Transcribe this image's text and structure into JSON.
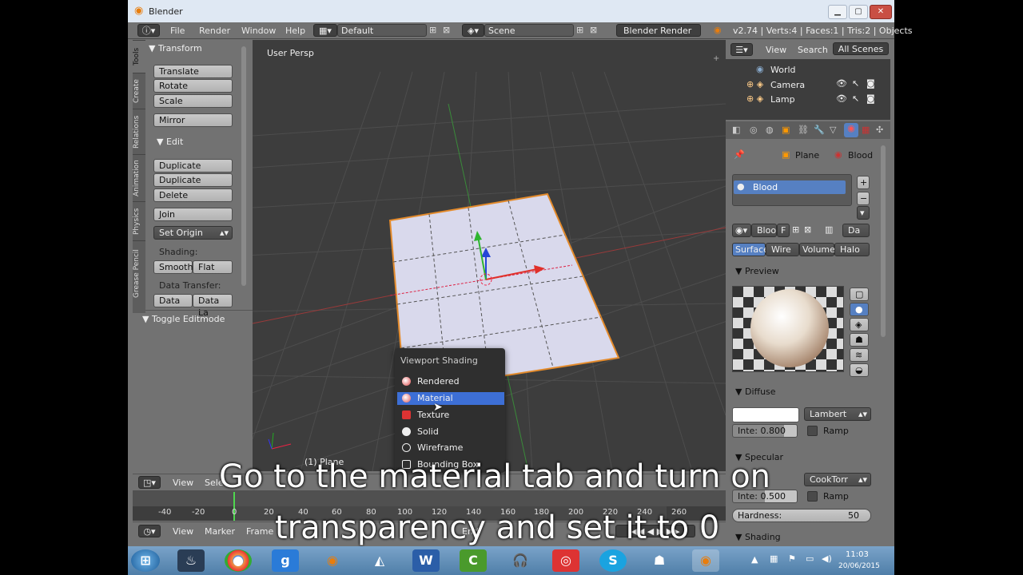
{
  "window": {
    "title": "Blender"
  },
  "topbar": {
    "menus": [
      "File",
      "Render",
      "Window",
      "Help"
    ],
    "layout": "Default",
    "scene": "Scene",
    "engine": "Blender Render",
    "stats": "v2.74 | Verts:4 | Faces:1 | Tris:2 | Objects"
  },
  "tool_tabs": [
    "Tools",
    "Create",
    "Relations",
    "Animation",
    "Physics",
    "Grease Pencil"
  ],
  "tools": {
    "transform_header": "Transform",
    "translate": "Translate",
    "rotate": "Rotate",
    "scale": "Scale",
    "mirror": "Mirror",
    "edit_header": "Edit",
    "duplicate": "Duplicate",
    "duplicate_linked": "Duplicate Linked",
    "delete": "Delete",
    "join": "Join",
    "set_origin": "Set Origin",
    "shading_label": "Shading:",
    "smooth": "Smooth",
    "flat": "Flat",
    "data_transfer_label": "Data Transfer:",
    "data": "Data",
    "data_la": "Data La",
    "toggle_editmode": "Toggle Editmode"
  },
  "viewport": {
    "label": "User Persp",
    "object_label": "(1) Plane"
  },
  "shading_popup": {
    "title": "Viewport Shading",
    "items": [
      "Rendered",
      "Material",
      "Texture",
      "Solid",
      "Wireframe",
      "Bounding Box"
    ],
    "selected": "Material"
  },
  "view3d_header": {
    "view": "View",
    "select": "Sele"
  },
  "timeline": {
    "ticks": [
      "-40",
      "-20",
      "0",
      "20",
      "40",
      "60",
      "80",
      "100",
      "120",
      "140",
      "160",
      "180",
      "200",
      "220",
      "240",
      "260"
    ],
    "header": [
      "View",
      "Marker",
      "Frame"
    ],
    "end_label": "End"
  },
  "outliner": {
    "view": "View",
    "search": "Search",
    "all_scenes": "All Scenes",
    "items": [
      "World",
      "Camera",
      "Lamp"
    ]
  },
  "properties": {
    "breadcrumb_object": "Plane",
    "breadcrumb_material": "Blood",
    "material_slot": "Blood",
    "material_name": "Bloo",
    "f_label": "F",
    "da_label": "Da",
    "tabs": [
      "Surface",
      "Wire",
      "Volume",
      "Halo"
    ],
    "preview_header": "Preview",
    "diffuse_header": "Diffuse",
    "diffuse_shader": "Lambert",
    "diffuse_intensity": "Inte: 0.800",
    "ramp": "Ramp",
    "specular_header": "Specular",
    "specular_shader": "CookTorr",
    "specular_intensity": "Inte: 0.500",
    "hardness_label": "Hardness:",
    "hardness_value": "50",
    "shading_header": "Shading"
  },
  "subtitle": {
    "line1": "Go to the material tab and turn on",
    "line2": "transparency and set it to 0"
  },
  "taskbar": {
    "time": "11:03",
    "date": "20/06/2015"
  },
  "colors": {
    "accent": "#5680c2",
    "selection": "#e38a2b",
    "popup_highlight": "#3d6fd6"
  }
}
